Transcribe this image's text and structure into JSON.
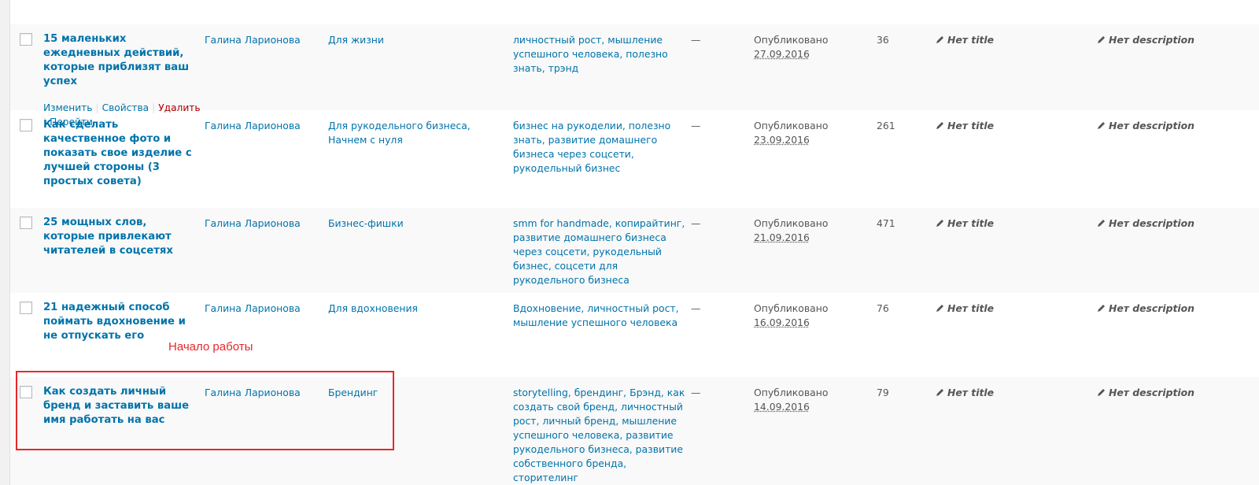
{
  "rows": [
    {
      "title": "15 маленьких ежедневных действий, которые приблизят ваш успех",
      "author": "Галина Ларионова",
      "categories": "Для жизни",
      "tags": "личностный рост, мышление успешного человека, полезно знать, трэнд",
      "dash": "—",
      "status": "Опубликовано",
      "date": "27.09.2016",
      "count": "36",
      "seo_title": "Нет title",
      "seo_description": "Нет description",
      "actions": {
        "edit": "Изменить",
        "props": "Свойства",
        "delete": "Удалить",
        "view": "Перейти"
      }
    },
    {
      "title": "Как сделать качественное фото и показать свое изделие с лучшей стороны (3 простых совета)",
      "author": "Галина Ларионова",
      "categories": "Для рукодельного бизнеса, Начнем с нуля",
      "tags": "бизнес на рукоделии, полезно знать, развитие домашнего бизнеса через соцсети, рукодельный бизнес",
      "dash": "—",
      "status": "Опубликовано",
      "date": "23.09.2016",
      "count": "261",
      "seo_title": "Нет title",
      "seo_description": "Нет description"
    },
    {
      "title": "25 мощных слов, которые привлекают читателей в соцсетях",
      "author": "Галина Ларионова",
      "categories": "Бизнес-фишки",
      "tags": "smm for handmade, копирайтинг, развитие домашнего бизнеса через соцсети, рукодельный бизнес, соцсети для рукодельного бизнеса",
      "dash": "—",
      "status": "Опубликовано",
      "date": "21.09.2016",
      "count": "471",
      "seo_title": "Нет title",
      "seo_description": "Нет description"
    },
    {
      "title": "21 надежный способ поймать вдохновение и не отпускать его",
      "author": "Галина Ларионова",
      "categories": "Для вдохновения",
      "tags": "Вдохновение, личностный рост, мышление успешного человека",
      "dash": "—",
      "status": "Опубликовано",
      "date": "16.09.2016",
      "count": "76",
      "seo_title": "Нет title",
      "seo_description": "Нет description"
    },
    {
      "title": "Как создать личный бренд и заставить ваше имя работать на вас",
      "author": "Галина Ларионова",
      "categories": "Брендинг",
      "tags": "storytelling, брендинг, Брэнд, как создать свой бренд, личностный рост, личный бренд, мышление успешного человека, развитие рукодельного бизнеса, развитие собственного бренда, сторителинг",
      "dash": "—",
      "status": "Опубликовано",
      "date": "14.09.2016",
      "count": "79",
      "seo_title": "Нет title",
      "seo_description": "Нет description"
    }
  ],
  "annotation": {
    "label": "Начало работы",
    "color": "#e8262b"
  },
  "colors": {
    "link": "#0073aa",
    "delete": "#a00",
    "row_alt": "#f9f9f9"
  },
  "icons": {
    "seo": "pencil-icon"
  }
}
